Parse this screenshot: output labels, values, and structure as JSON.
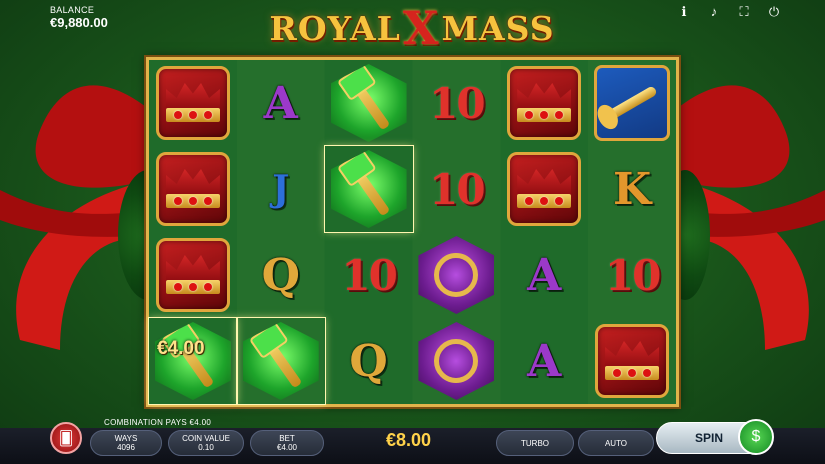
{
  "balance": {
    "label": "BALANCE",
    "value": "€9,880.00"
  },
  "logo": {
    "part1": "ROYAL",
    "x": "X",
    "part2": "MASS"
  },
  "top_icons": [
    "info-icon",
    "sound-icon",
    "fullscreen-icon",
    "power-icon"
  ],
  "reels": [
    [
      "crown",
      "crown",
      "crown",
      "scepter"
    ],
    [
      "A",
      "J",
      "Q",
      "scepter"
    ],
    [
      "scepter",
      "scepter",
      "10",
      "Q"
    ],
    [
      "10",
      "10",
      "ring",
      "ring"
    ],
    [
      "crown",
      "crown",
      "A",
      "A"
    ],
    [
      "trumpet",
      "K",
      "10",
      "crown"
    ]
  ],
  "winning_cells": [
    [
      2,
      1
    ],
    [
      0,
      3
    ],
    [
      1,
      3
    ]
  ],
  "win_label": "€4.00",
  "combination": "COMBINATION PAYS €4.00",
  "controls": {
    "ways_label": "WAYS",
    "ways_value": "4096",
    "coin_label": "COIN VALUE",
    "coin_value": "0.10",
    "bet_label": "BET",
    "bet_value": "€4.00",
    "total_win": "€8.00",
    "turbo": "TURBO",
    "auto": "AUTO",
    "spin": "SPIN"
  }
}
